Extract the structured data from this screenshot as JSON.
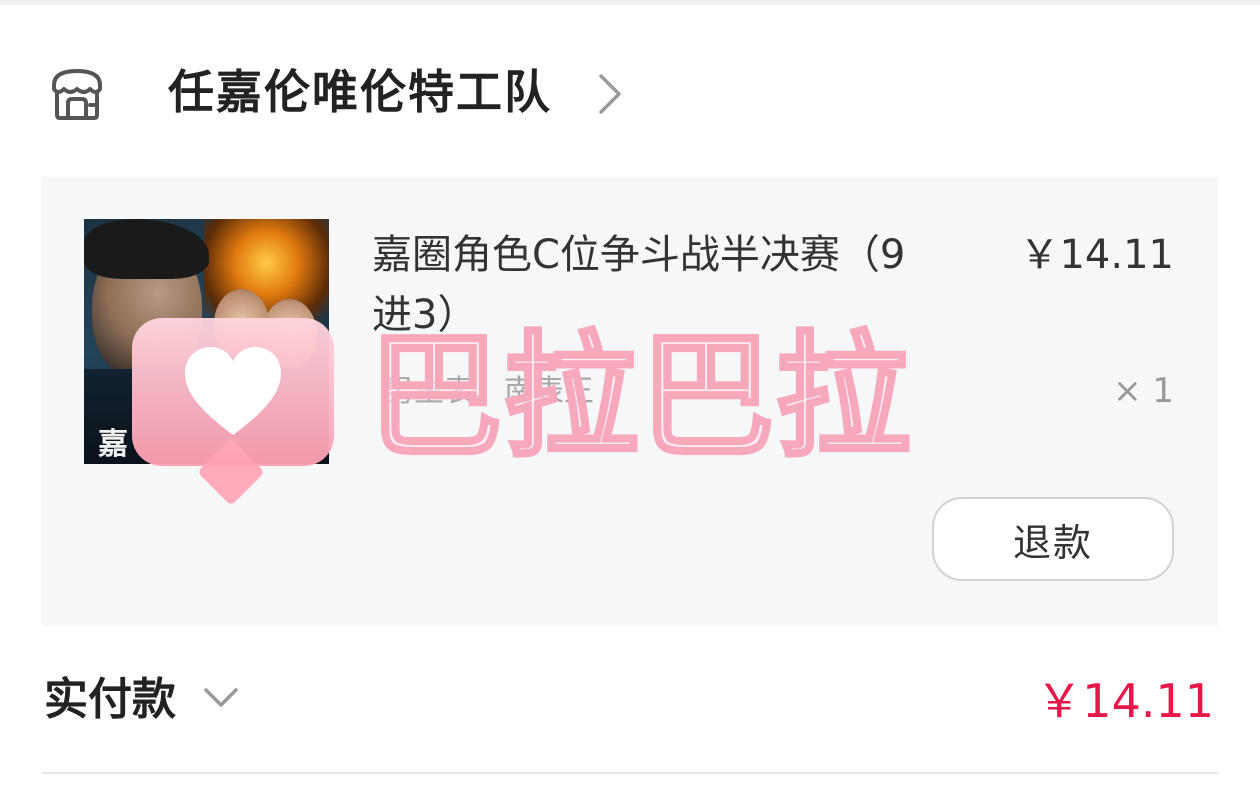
{
  "shop": {
    "name": "任嘉伦唯伦特工队",
    "icon": "storefront-icon",
    "chevron_icon": "chevron-right-icon"
  },
  "item": {
    "title": "嘉圈角色C位争斗战半决赛（9进3）",
    "price": "￥14.11",
    "spec": "男主表、南表王",
    "quantity": "× 1",
    "thumbnail_text": "嘉",
    "refund_label": "退款"
  },
  "payment": {
    "label": "实付款",
    "chevron_icon": "chevron-down-icon",
    "amount": "￥14.11"
  },
  "watermark": {
    "text": "巴拉巴拉",
    "icon": "heart-icon"
  },
  "colors": {
    "accent_price": "#e8174a",
    "card_bg": "#f6f7f9",
    "watermark_pink": "#f7a9bb"
  }
}
